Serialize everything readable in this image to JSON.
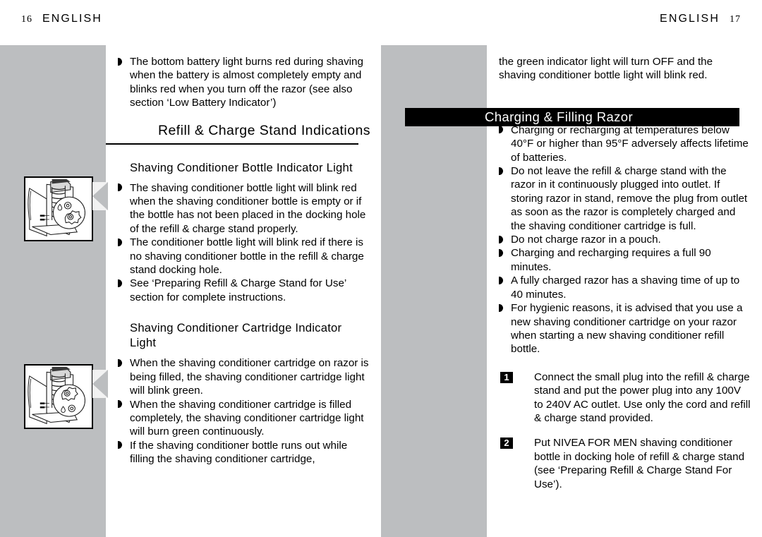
{
  "document": {
    "language_head": "ENGLISH",
    "left_page": {
      "folio": "16"
    },
    "right_page": {
      "folio": "17"
    }
  },
  "left_column": {
    "intro_bullets": [
      "The bottom battery light burns red during shaving when the battery is almost completely empty and blinks red when you turn off the razor (see also section ‘Low Battery Indicator’)"
    ],
    "section_heading": "Refill & Charge Stand Indications",
    "subsection_1": {
      "heading": "Shaving Conditioner Bottle Indicator Light",
      "bullets": [
        "The shaving conditioner bottle light will blink red when the shaving conditioner bottle is empty or if the bottle has not been placed in the docking hole of the refill & charge stand properly.",
        "The conditioner bottle light will blink red if there is no shaving conditioner bottle in the refill & charge stand docking hole.",
        "See ‘Preparing Refill & Charge Stand for Use’ section for complete instructions."
      ],
      "figure_name": "razor-in-charge-stand-bottle-light-illustration"
    },
    "subsection_2": {
      "heading": "Shaving Conditioner Cartridge Indicator Light",
      "bullets": [
        "When the shaving conditioner cartridge on razor is being filled, the shaving conditioner cartridge light will blink green.",
        "When the shaving conditioner cartridge is filled completely, the shaving conditioner cartridge light will burn green continuously.",
        "If the shaving conditioner bottle runs out while filling the shaving conditioner cartridge,"
      ],
      "figure_name": "razor-in-charge-stand-cartridge-light-illustration"
    }
  },
  "right_column": {
    "continuation_text": "the green indicator light will turn OFF and the shaving conditioner bottle light will blink red.",
    "banner_heading": "Charging & Filling Razor",
    "bullets": [
      "Charging or recharging at temperatures below 40°F or higher than 95°F adversely affects lifetime of batteries.",
      "Do not leave the refill & charge stand with the razor in it continuously plugged into outlet.  If storing razor in stand, remove the plug from outlet as soon as the razor is completely charged and the shaving conditioner cartridge is full.",
      "Do not charge razor in a pouch.",
      "Charging and recharging requires a full 90 minutes.",
      "A fully charged razor has a shaving time of up to 40 minutes.",
      "For hygienic reasons, it is advised that you use a new shaving conditioner cartridge on your razor when starting a new shaving conditioner refill bottle."
    ],
    "steps": [
      {
        "number": "1",
        "text": "Connect the small plug into the refill & charge stand and put the power plug into any 100V to 240V AC outlet. Use only the cord and refill & charge stand provided."
      },
      {
        "number": "2",
        "text": "Put NIVEA FOR MEN shaving conditioner bottle in docking hole of refill & charge stand (see ‘Preparing Refill & Charge Stand For Use’)."
      }
    ]
  },
  "colors": {
    "gray_band": "#bcbec0",
    "banner_background": "#000000",
    "banner_text": "#ffffff",
    "body_text": "#000000",
    "page_background": "#ffffff"
  }
}
